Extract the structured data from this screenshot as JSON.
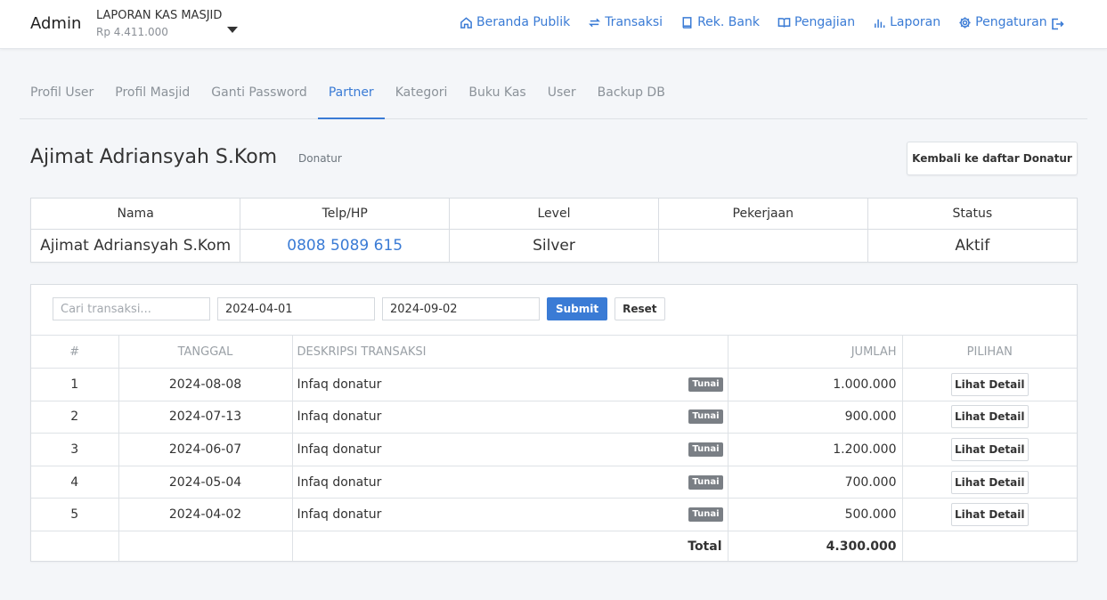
{
  "navbar": {
    "brand": "Admin",
    "org_name": "LAPORAN KAS MASJID",
    "org_balance": "Rp 4.411.000",
    "items": [
      {
        "label": "Beranda Publik",
        "icon": "home-icon"
      },
      {
        "label": "Transaksi",
        "icon": "exchange-icon"
      },
      {
        "label": "Rek. Bank",
        "icon": "book-icon"
      },
      {
        "label": "Pengajian",
        "icon": "open-book-icon"
      },
      {
        "label": "Laporan",
        "icon": "bar-chart-icon"
      },
      {
        "label": "Pengaturan",
        "icon": "gear-icon"
      }
    ],
    "logout_icon": "logout-icon"
  },
  "tabs": [
    {
      "label": "Profil User",
      "active": false
    },
    {
      "label": "Profil Masjid",
      "active": false
    },
    {
      "label": "Ganti Password",
      "active": false
    },
    {
      "label": "Partner",
      "active": true
    },
    {
      "label": "Kategori",
      "active": false
    },
    {
      "label": "Buku Kas",
      "active": false
    },
    {
      "label": "User",
      "active": false
    },
    {
      "label": "Backup DB",
      "active": false
    }
  ],
  "partner": {
    "name": "Ajimat Adriansyah S.Kom",
    "role": "Donatur",
    "back_button": "Kembali ke daftar Donatur"
  },
  "profile_table": {
    "headers": [
      "Nama",
      "Telp/HP",
      "Level",
      "Pekerjaan",
      "Status"
    ],
    "values": {
      "nama": "Ajimat Adriansyah S.Kom",
      "telp": "0808 5089 615",
      "level": "Silver",
      "pekerjaan": "",
      "status": "Aktif"
    }
  },
  "filter": {
    "search_placeholder": "Cari transaksi...",
    "search_value": "",
    "date_from": "2024-04-01",
    "date_to": "2024-09-02",
    "submit_label": "Submit",
    "reset_label": "Reset"
  },
  "transactions": {
    "headers": {
      "no": "#",
      "date": "TANGGAL",
      "desc": "DESKRIPSI TRANSAKSI",
      "amount": "JUMLAH",
      "options": "PILIHAN"
    },
    "rows": [
      {
        "no": "1",
        "date": "2024-08-08",
        "desc": "Infaq donatur",
        "badge": "Tunai",
        "amount": "1.000.000",
        "action": "Lihat Detail"
      },
      {
        "no": "2",
        "date": "2024-07-13",
        "desc": "Infaq donatur",
        "badge": "Tunai",
        "amount": "900.000",
        "action": "Lihat Detail"
      },
      {
        "no": "3",
        "date": "2024-06-07",
        "desc": "Infaq donatur",
        "badge": "Tunai",
        "amount": "1.200.000",
        "action": "Lihat Detail"
      },
      {
        "no": "4",
        "date": "2024-05-04",
        "desc": "Infaq donatur",
        "badge": "Tunai",
        "amount": "700.000",
        "action": "Lihat Detail"
      },
      {
        "no": "5",
        "date": "2024-04-02",
        "desc": "Infaq donatur",
        "badge": "Tunai",
        "amount": "500.000",
        "action": "Lihat Detail"
      }
    ],
    "total_label": "Total",
    "total_value": "4.300.000"
  },
  "colors": {
    "accent": "#3a7bd5",
    "badge": "#7a7f85",
    "background": "#f4f6f9"
  }
}
